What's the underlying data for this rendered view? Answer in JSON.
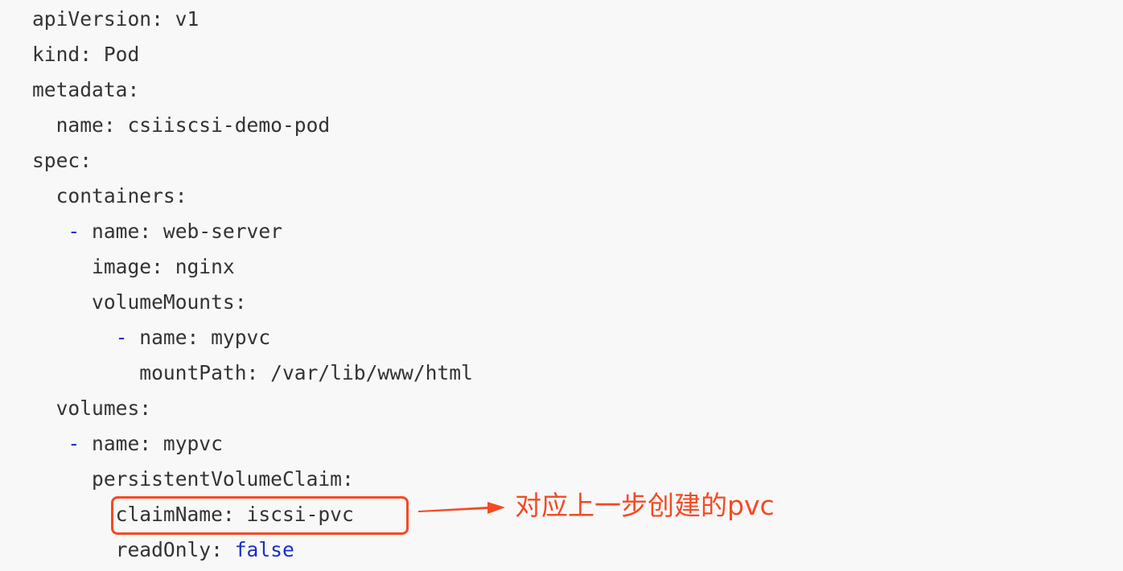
{
  "code": {
    "lines": [
      {
        "indent": "",
        "dash": "",
        "text": "apiVersion: v1",
        "bool": ""
      },
      {
        "indent": "",
        "dash": "",
        "text": "kind: Pod",
        "bool": ""
      },
      {
        "indent": "",
        "dash": "",
        "text": "metadata:",
        "bool": ""
      },
      {
        "indent": "  ",
        "dash": "",
        "text": "name: csiiscsi-demo-pod",
        "bool": ""
      },
      {
        "indent": "",
        "dash": "",
        "text": "spec:",
        "bool": ""
      },
      {
        "indent": "  ",
        "dash": "",
        "text": "containers:",
        "bool": ""
      },
      {
        "indent": "   ",
        "dash": "- ",
        "text": "name: web-server",
        "bool": ""
      },
      {
        "indent": "     ",
        "dash": "",
        "text": "image: nginx",
        "bool": ""
      },
      {
        "indent": "     ",
        "dash": "",
        "text": "volumeMounts:",
        "bool": ""
      },
      {
        "indent": "       ",
        "dash": "- ",
        "text": "name: mypvc",
        "bool": ""
      },
      {
        "indent": "         ",
        "dash": "",
        "text": "mountPath: /var/lib/www/html",
        "bool": ""
      },
      {
        "indent": "  ",
        "dash": "",
        "text": "volumes:",
        "bool": ""
      },
      {
        "indent": "   ",
        "dash": "- ",
        "text": "name: mypvc",
        "bool": ""
      },
      {
        "indent": "     ",
        "dash": "",
        "text": "persistentVolumeClaim:",
        "bool": ""
      },
      {
        "indent": "       ",
        "dash": "",
        "text": "claimName: iscsi-pvc",
        "bool": ""
      },
      {
        "indent": "       ",
        "dash": "",
        "text": "readOnly: ",
        "bool": "false"
      }
    ]
  },
  "annotation": {
    "text": "对应上一步创建的pvc"
  },
  "colors": {
    "text": "#333333",
    "keyword_blue": "#1a2ec8",
    "annotation_red": "#f44a24",
    "background": "#f8f8f8"
  }
}
